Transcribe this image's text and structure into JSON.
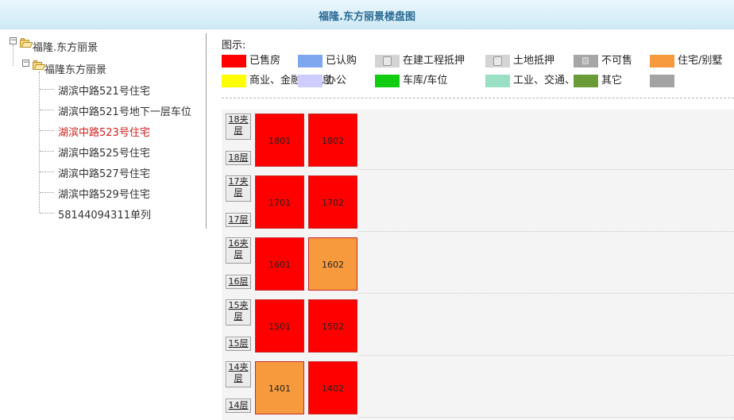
{
  "header": {
    "title": "福隆.东方丽景楼盘图"
  },
  "tree": {
    "root_label": "福隆.东方丽景",
    "child_label": "福隆东方丽景",
    "leaves": [
      {
        "label": "湖滨中路521号住宅",
        "active": false
      },
      {
        "label": "湖滨中路521号地下一层车位",
        "active": false
      },
      {
        "label": "湖滨中路523号住宅",
        "active": true
      },
      {
        "label": "湖滨中路525号住宅",
        "active": false
      },
      {
        "label": "湖滨中路527号住宅",
        "active": false
      },
      {
        "label": "湖滨中路529号住宅",
        "active": false
      },
      {
        "label": "58144094311单列",
        "active": false
      }
    ]
  },
  "legend": {
    "title": "图示:",
    "row1": [
      {
        "label": "已售房",
        "color": "#ff0000",
        "icon": ""
      },
      {
        "label": "已认购",
        "color": "#7fa7f0",
        "icon": ""
      },
      {
        "label": "在建工程抵押",
        "color": "#d4d4d4",
        "icon": "mortgage-icon"
      },
      {
        "label": "土地抵押",
        "color": "#d4d4d4",
        "icon": "mortgage-icon"
      },
      {
        "label": "不可售",
        "color": "#a6a6a6",
        "icon": "lock-icon"
      },
      {
        "label": "住宅/别墅",
        "color": "#f79a3e",
        "icon": ""
      }
    ],
    "row2": [
      {
        "label": "商业、金融、信息",
        "color": "#ffff00",
        "icon": ""
      },
      {
        "label": "办公",
        "color": "#ccccff",
        "icon": ""
      },
      {
        "label": "车库/车位",
        "color": "#11cc11",
        "icon": ""
      },
      {
        "label": "工业、交通、仓储",
        "color": "#99e0c4",
        "icon": ""
      },
      {
        "label": "其它",
        "color": "#6b9b36",
        "icon": ""
      },
      {
        "label": "",
        "color": "#a3a3a3",
        "icon": ""
      }
    ]
  },
  "floors": [
    {
      "mezzanine_line1": "18夹",
      "mezzanine_line2": "层",
      "label": "18层",
      "units": [
        {
          "number": "1801",
          "color": "#ff0000"
        },
        {
          "number": "1802",
          "color": "#ff0000"
        }
      ]
    },
    {
      "mezzanine_line1": "17夹",
      "mezzanine_line2": "层",
      "label": "17层",
      "units": [
        {
          "number": "1701",
          "color": "#ff0000"
        },
        {
          "number": "1702",
          "color": "#ff0000"
        }
      ]
    },
    {
      "mezzanine_line1": "16夹",
      "mezzanine_line2": "层",
      "label": "16层",
      "units": [
        {
          "number": "1601",
          "color": "#ff0000"
        },
        {
          "number": "1602",
          "color": "#f79a3e"
        }
      ]
    },
    {
      "mezzanine_line1": "15夹",
      "mezzanine_line2": "层",
      "label": "15层",
      "units": [
        {
          "number": "1501",
          "color": "#ff0000"
        },
        {
          "number": "1502",
          "color": "#ff0000"
        }
      ]
    },
    {
      "mezzanine_line1": "14夹",
      "mezzanine_line2": "层",
      "label": "14层",
      "units": [
        {
          "number": "1401",
          "color": "#f79a3e"
        },
        {
          "number": "1402",
          "color": "#ff0000"
        }
      ]
    }
  ]
}
